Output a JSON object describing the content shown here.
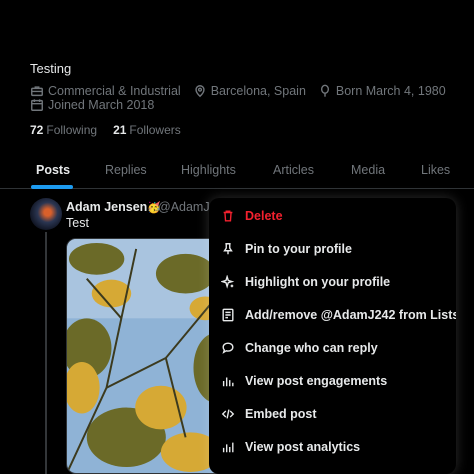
{
  "profile": {
    "bio": "Testing",
    "category": "Commercial & Industrial",
    "location": "Barcelona, Spain",
    "born": "Born March 4, 1980",
    "joined": "Joined March 2018",
    "following_count": "72",
    "following_label": "Following",
    "followers_count": "21",
    "followers_label": "Followers"
  },
  "tabs": [
    {
      "label": "Posts",
      "active": true
    },
    {
      "label": "Replies"
    },
    {
      "label": "Highlights"
    },
    {
      "label": "Articles"
    },
    {
      "label": "Media"
    },
    {
      "label": "Likes"
    }
  ],
  "post": {
    "author_name": "Adam Jensen",
    "author_emoji": "🥳",
    "handle": "@AdamJ2",
    "text": "Test"
  },
  "menu": [
    {
      "label": "Delete",
      "icon": "trash-icon",
      "color": "#f4212e"
    },
    {
      "label": "Pin to your profile",
      "icon": "pin-icon"
    },
    {
      "label": "Highlight on your profile",
      "icon": "sparkle-icon"
    },
    {
      "label": "Add/remove @AdamJ242 from Lists",
      "icon": "list-icon"
    },
    {
      "label": "Change who can reply",
      "icon": "speech-bubble-icon"
    },
    {
      "label": "View post engagements",
      "icon": "bar-chart-icon"
    },
    {
      "label": "Embed post",
      "icon": "code-icon"
    },
    {
      "label": "View post analytics",
      "icon": "analytics-icon"
    }
  ],
  "colors": {
    "accent": "#1d9bf0",
    "danger": "#f4212e",
    "muted": "#71767b",
    "background": "#000000"
  }
}
